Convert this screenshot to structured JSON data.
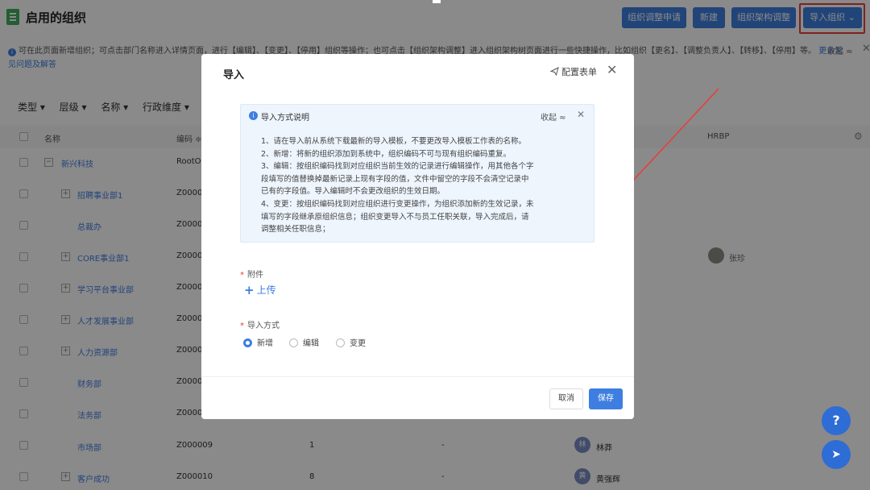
{
  "header": {
    "title": "启用的组织",
    "buttons": [
      "组织调整申请",
      "新建",
      "组织架构调整",
      "导入组织"
    ],
    "caret": "▾",
    "import_caret": "⌄"
  },
  "info": {
    "text": "可在此页面新增组织；可点击部门名称进入详情页面，进行【编辑】、【变更】、【停用】组织等操作；也可点击【组织架构调整】进入组织架构树页面进行一些快捷操作，比如组织【更名】、【调整负责人】、【转移】、【停用】等。",
    "link": "更多常见问题及解答",
    "collapse": "收起 ≈",
    "close": "✕"
  },
  "filters": [
    "类型 ▾",
    "层级 ▾",
    "名称 ▾",
    "行政维度 ▾"
  ],
  "table": {
    "headers": {
      "name": "名称",
      "code": "编码 ≑",
      "hrbp": "HRBP"
    },
    "rows": [
      {
        "name": "新兴科技",
        "code": "RootOr",
        "expand": "−"
      },
      {
        "name": "招聘事业部1",
        "code": "Z00000",
        "expand": "+"
      },
      {
        "name": "总裁办",
        "code": "Z00000",
        "expand": ""
      },
      {
        "name": "CORE事业部1",
        "code": "Z00000",
        "expand": "+",
        "hrbp": "张珍"
      },
      {
        "name": "学习平台事业部",
        "code": "Z00000",
        "expand": "+"
      },
      {
        "name": "人才发展事业部",
        "code": "Z00000",
        "expand": "+"
      },
      {
        "name": "人力资源部",
        "code": "Z00000",
        "expand": "+"
      },
      {
        "name": "财务部",
        "code": "Z00000",
        "expand": ""
      },
      {
        "name": "法务部",
        "code": "Z00000",
        "expand": ""
      },
      {
        "name": "市场部",
        "code": "Z000009",
        "count": "1",
        "dash": "-",
        "owner_initial": "林",
        "owner": "林莽",
        "expand": ""
      },
      {
        "name": "客户成功",
        "code": "Z000010",
        "count": "8",
        "dash": "-",
        "owner_initial": "黄",
        "owner": "黄强辉",
        "expand": "+"
      }
    ]
  },
  "modal": {
    "title": "导入",
    "config": "配置表单",
    "close": "✕",
    "notice_title": "导入方式说明",
    "notice_collapse": "收起 ≈",
    "notice_close": "✕",
    "notice_lines": [
      "1、请在导入前从系统下载最新的导入模板，不要更改导入模板工作表的名称。",
      "2、新增：将新的组织添加到系统中，组织编码不可与现有组织编码重复。",
      "3、编辑：按组织编码找到对应组织当前生效的记录进行编辑操作，用其他各个字段填写的值替换掉最新记录上现有字段的值，文件中留空的字段不会清空记录中已有的字段值。导入编辑时不会更改组织的生效日期。",
      "4、变更：按组织编码找到对应组织进行变更操作，为组织添加新的生效记录，未填写的字段继承原组织信息；组织变更导入不与员工任职关联，导入完成后，请调整相关任职信息；"
    ],
    "attachment_label": "附件",
    "upload_label": "上传",
    "mode_label": "导入方式",
    "modes": [
      "新增",
      "编辑",
      "变更"
    ],
    "selected_mode": "新增",
    "cancel": "取消",
    "save": "保存"
  },
  "fab": {
    "help": "?",
    "send": "➤"
  },
  "colors": {
    "accent": "#3d7ee0",
    "highlight": "#e5403b",
    "arrow": "#e5403b"
  }
}
